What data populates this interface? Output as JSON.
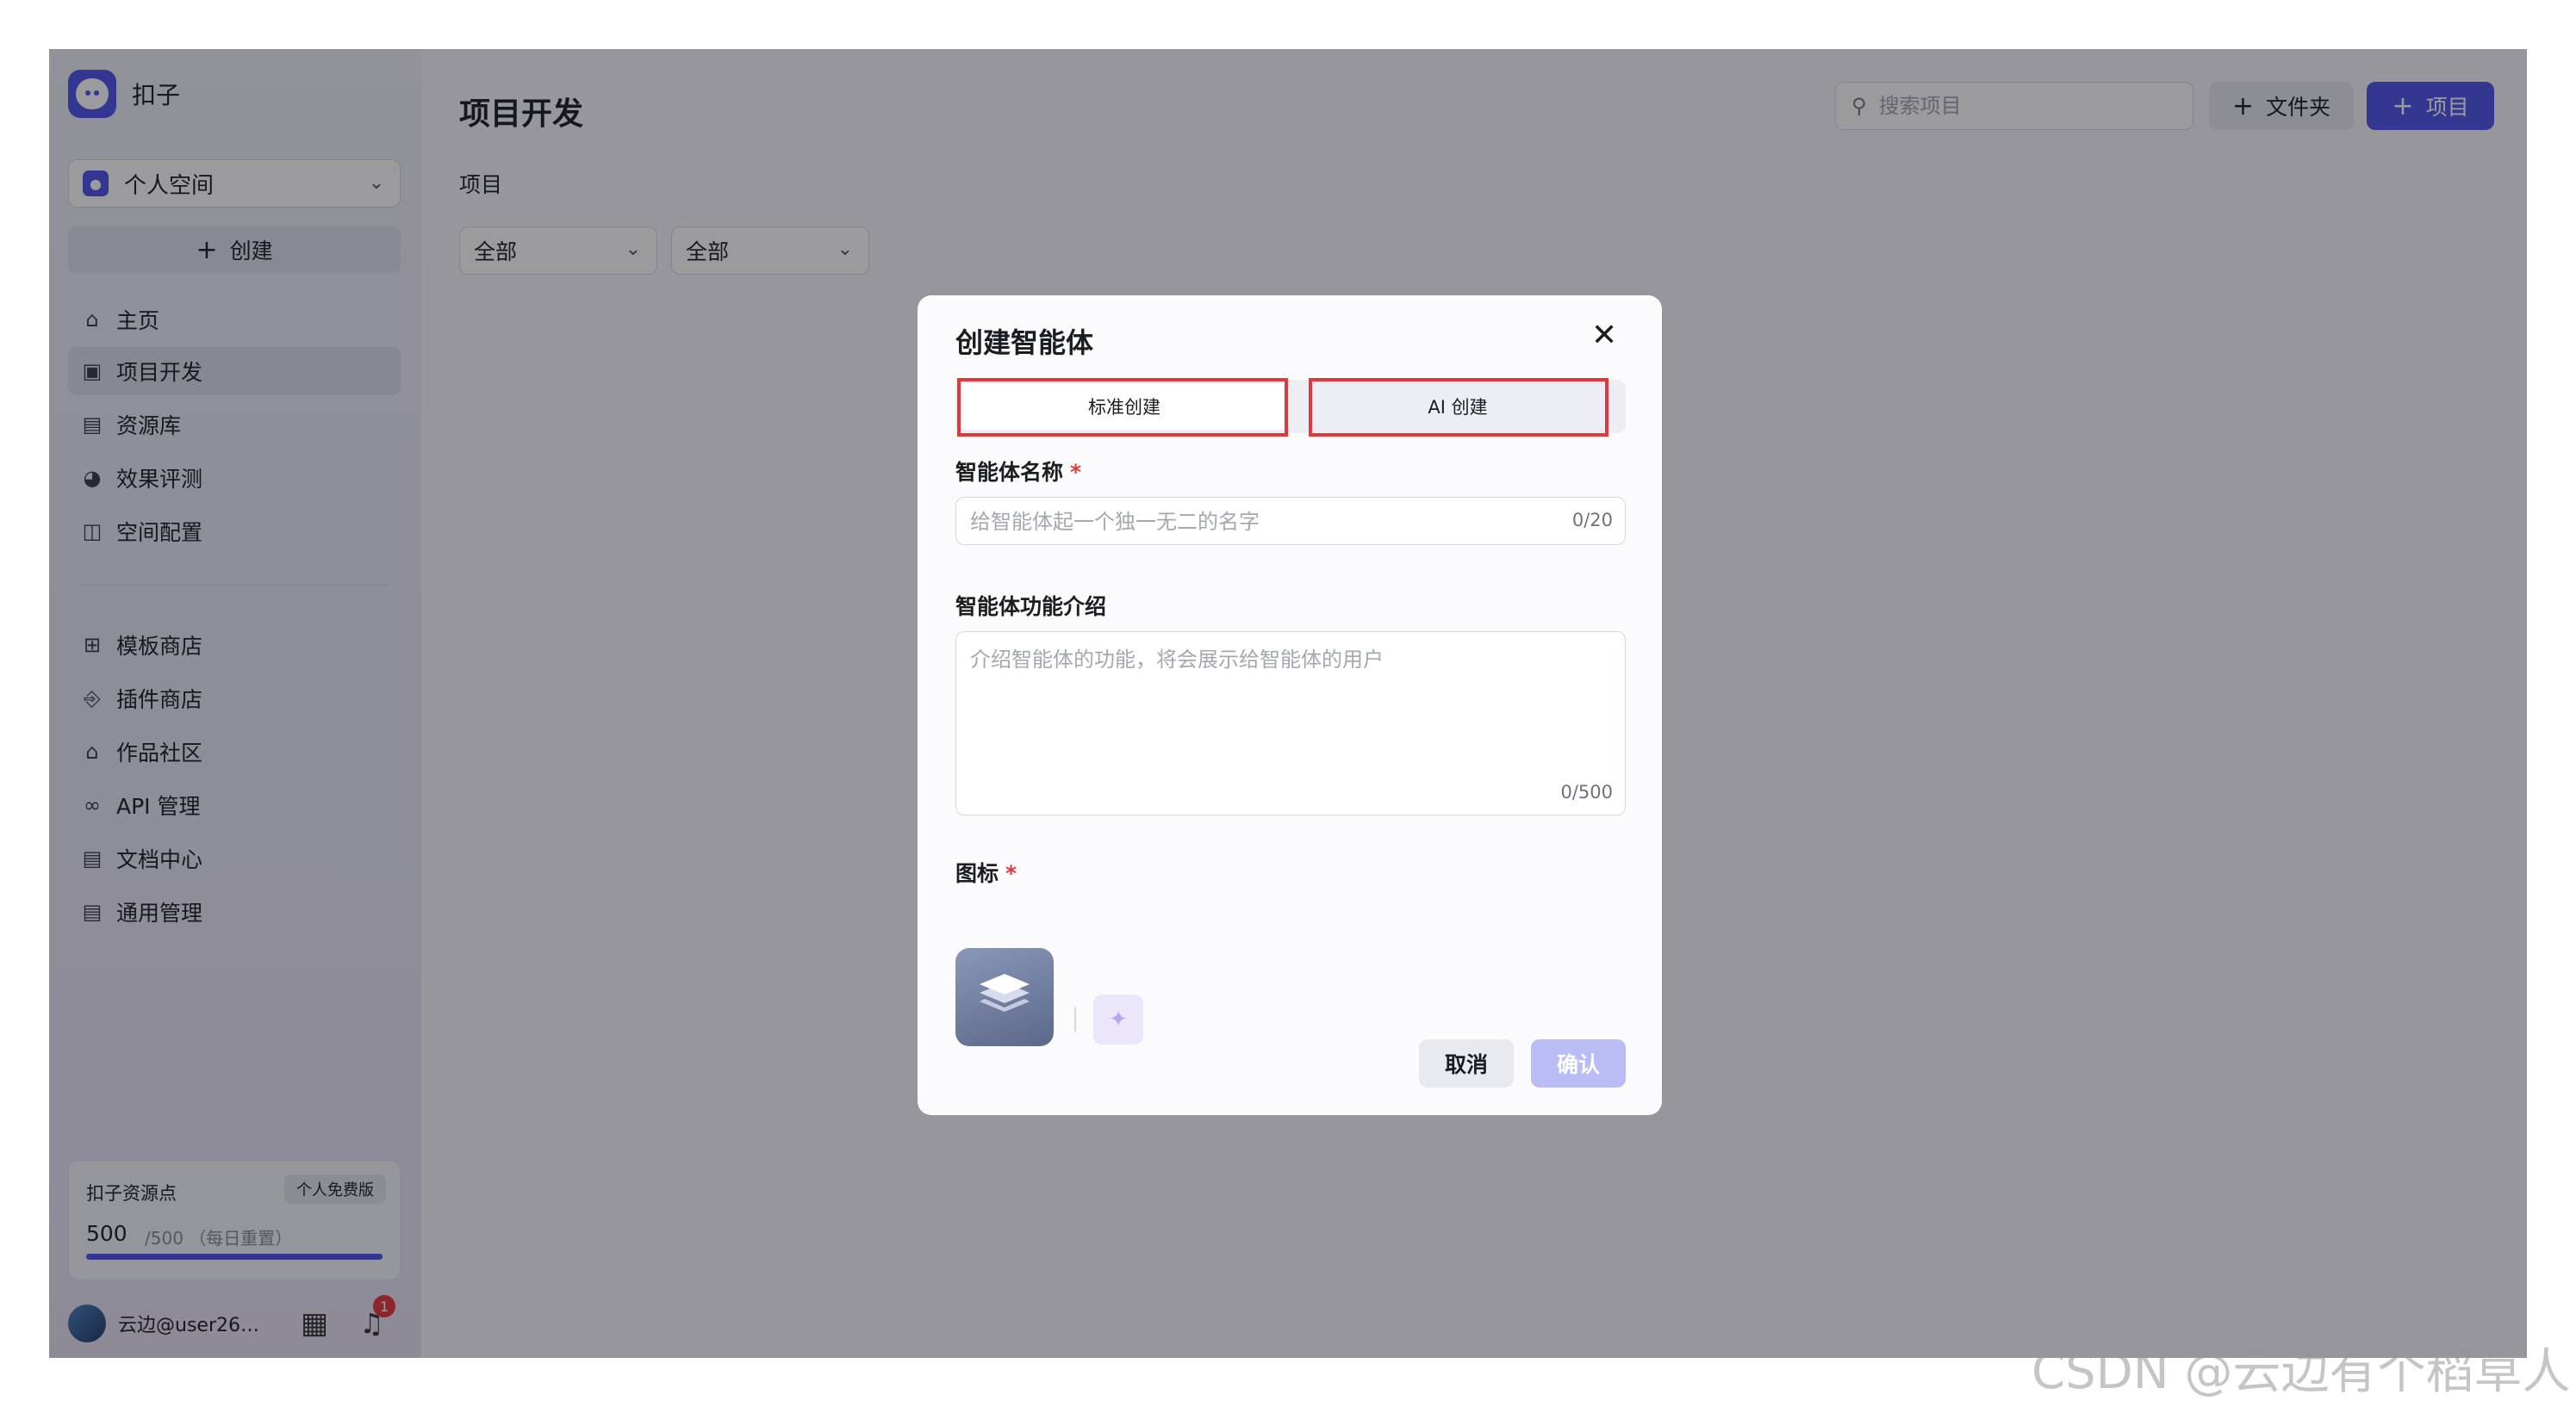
{
  "app": {
    "name": "扣子"
  },
  "sidebar": {
    "space": "个人空间",
    "create_label": "创建",
    "items": [
      {
        "label": "主页",
        "icon": "home-icon"
      },
      {
        "label": "项目开发",
        "icon": "robot-icon",
        "active": true
      },
      {
        "label": "资源库",
        "icon": "library-icon"
      },
      {
        "label": "效果评测",
        "icon": "gauge-icon"
      },
      {
        "label": "空间配置",
        "icon": "settings-panel-icon"
      }
    ],
    "items2": [
      {
        "label": "模板商店",
        "icon": "template-icon"
      },
      {
        "label": "插件商店",
        "icon": "plugin-icon"
      },
      {
        "label": "作品社区",
        "icon": "community-icon"
      },
      {
        "label": "API 管理",
        "icon": "link-icon"
      },
      {
        "label": "文档中心",
        "icon": "document-icon"
      },
      {
        "label": "通用管理",
        "icon": "inbox-icon"
      }
    ],
    "resource": {
      "title": "扣子资源点",
      "badge": "个人免费版",
      "used": "500",
      "total": "/500 （每日重置）",
      "progress": 1.0
    },
    "user": {
      "name": "云边@user268···",
      "notifications": "1"
    }
  },
  "main": {
    "title": "项目开发",
    "section": "项目",
    "filters": [
      "全部",
      "全部"
    ],
    "search_placeholder": "搜索项目",
    "folder_label": "文件夹",
    "project_label": "项目"
  },
  "modal": {
    "title": "创建智能体",
    "tabs": [
      "标准创建",
      "AI 创建"
    ],
    "name_label": "智能体名称",
    "name_placeholder": "给智能体起一个独一无二的名字",
    "name_counter": "0/20",
    "desc_label": "智能体功能介绍",
    "desc_placeholder": "介绍智能体的功能，将会展示给智能体的用户",
    "desc_counter": "0/500",
    "icon_label": "图标",
    "required_mark": "*",
    "cancel": "取消",
    "confirm": "确认"
  },
  "watermark": "CSDN @云边有个稻草人",
  "colors": {
    "accent": "#4d53e8",
    "highlight": "#e5363b"
  }
}
